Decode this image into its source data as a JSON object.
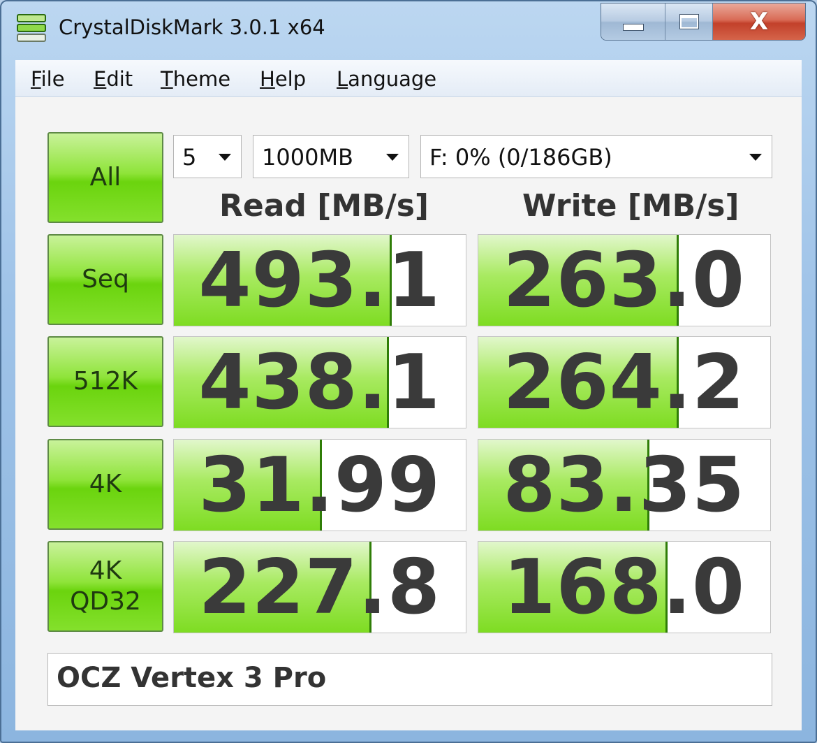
{
  "window": {
    "title": "CrystalDiskMark 3.0.1 x64",
    "buttons": {
      "minimize": "minimize",
      "maximize": "maximize",
      "close": "X"
    }
  },
  "menu": [
    {
      "label": "File",
      "mnemonic": "F",
      "rest": "ile"
    },
    {
      "label": "Edit",
      "mnemonic": "E",
      "rest": "dit"
    },
    {
      "label": "Theme",
      "mnemonic": "T",
      "rest": "heme"
    },
    {
      "label": "Help",
      "mnemonic": "H",
      "rest": "elp"
    },
    {
      "label": "Language",
      "mnemonic": "L",
      "rest": "anguage"
    }
  ],
  "settings": {
    "test_count": "5",
    "test_size": "1000MB",
    "drive": "F: 0% (0/186GB)"
  },
  "buttons": {
    "all": "All",
    "seq": "Seq",
    "k512": "512K",
    "k4": "4K",
    "qd32_line1": "4K",
    "qd32_line2": "QD32"
  },
  "columns": {
    "read": "Read [MB/s]",
    "write": "Write [MB/s]"
  },
  "results": {
    "seq": {
      "read": "493.1",
      "write": "263.0",
      "read_fill": 0.74,
      "write_fill": 0.68
    },
    "k512": {
      "read": "438.1",
      "write": "264.2",
      "read_fill": 0.73,
      "write_fill": 0.68
    },
    "k4": {
      "read": "31.99",
      "write": "83.35",
      "read_fill": 0.5,
      "write_fill": 0.58
    },
    "qd32": {
      "read": "227.8",
      "write": "168.0",
      "read_fill": 0.67,
      "write_fill": 0.64
    }
  },
  "comment": "OCZ Vertex 3 Pro",
  "colors": {
    "button_green": "#6bd40e",
    "bar_green": "#7edc22",
    "value_text": "#3a3a3a"
  },
  "icons": {
    "app": "disk-stack-icon",
    "dropdown": "dropdown-arrow-icon"
  }
}
